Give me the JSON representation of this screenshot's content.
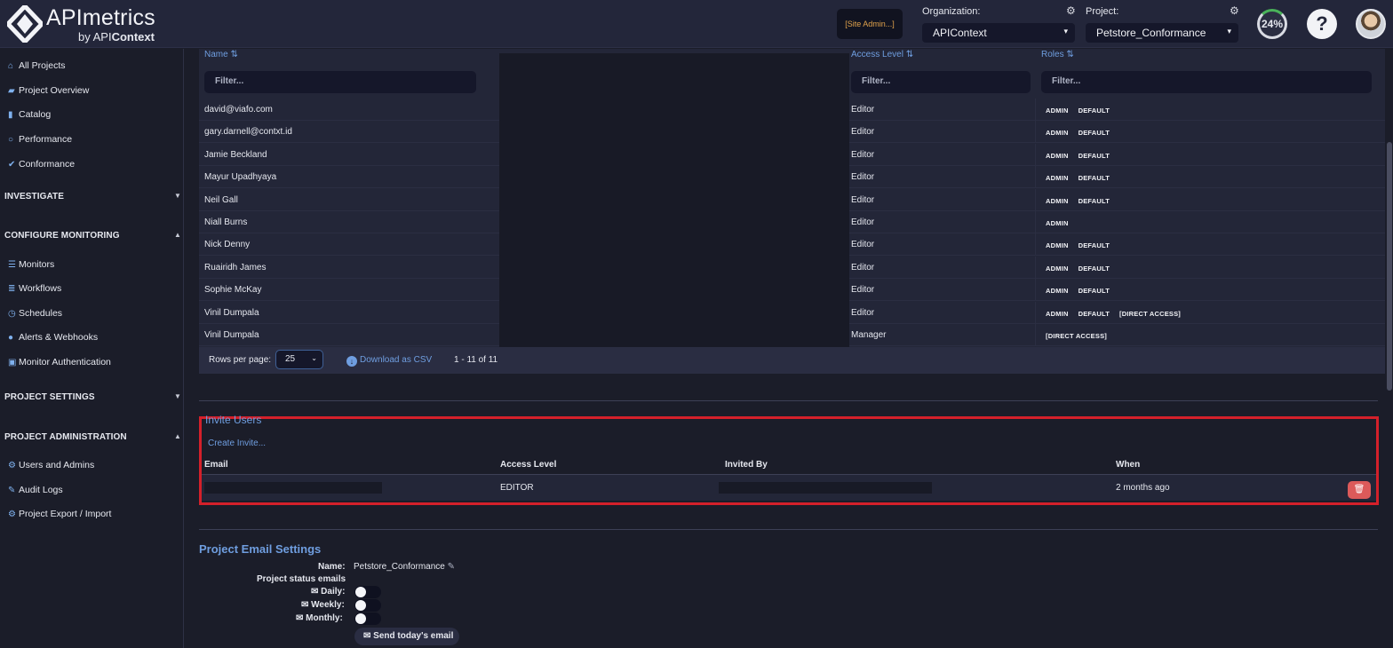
{
  "header": {
    "brand": "APImetrics",
    "brand_by": "by API",
    "brand_by_bold": "Context",
    "site_admin": "[Site Admin...]",
    "org_label": "Organization:",
    "org_value": "APIContext",
    "project_label": "Project:",
    "project_value": "Petstore_Conformance",
    "progress": "24%",
    "help": "?"
  },
  "sidebar": {
    "top_items": [
      {
        "label": "All Projects",
        "icon": "home-icon"
      },
      {
        "label": "Project Overview",
        "icon": "folder-icon"
      },
      {
        "label": "Catalog",
        "icon": "book-icon"
      },
      {
        "label": "Performance",
        "icon": "circle-icon"
      },
      {
        "label": "Conformance",
        "icon": "check-icon"
      }
    ],
    "investigate": "INVESTIGATE",
    "configure": "CONFIGURE MONITORING",
    "configure_items": [
      {
        "label": "Monitors",
        "icon": "list-icon"
      },
      {
        "label": "Workflows",
        "icon": "workflow-icon"
      },
      {
        "label": "Schedules",
        "icon": "clock-icon"
      },
      {
        "label": "Alerts & Webhooks",
        "icon": "globe-icon"
      },
      {
        "label": "Monitor Authentication",
        "icon": "lock-icon"
      }
    ],
    "project_settings": "PROJECT SETTINGS",
    "project_admin": "PROJECT ADMINISTRATION",
    "admin_items": [
      {
        "label": "Users and Admins",
        "icon": "gear-icon"
      },
      {
        "label": "Audit Logs",
        "icon": "edit-icon"
      },
      {
        "label": "Project Export / Import",
        "icon": "gear-icon"
      }
    ]
  },
  "users_table": {
    "headers": {
      "name": "Name",
      "access": "Access Level",
      "roles": "Roles"
    },
    "filter_placeholder": "Filter...",
    "rows": [
      {
        "name": "david@viafo.com",
        "access": "Editor",
        "roles": [
          "ADMIN",
          "DEFAULT"
        ]
      },
      {
        "name": "gary.darnell@contxt.id",
        "access": "Editor",
        "roles": [
          "ADMIN",
          "DEFAULT"
        ]
      },
      {
        "name": "Jamie Beckland",
        "access": "Editor",
        "roles": [
          "ADMIN",
          "DEFAULT"
        ]
      },
      {
        "name": "Mayur Upadhyaya",
        "access": "Editor",
        "roles": [
          "ADMIN",
          "DEFAULT"
        ]
      },
      {
        "name": "Neil Gall",
        "access": "Editor",
        "roles": [
          "ADMIN",
          "DEFAULT"
        ]
      },
      {
        "name": "Niall Burns",
        "access": "Editor",
        "roles": [
          "ADMIN"
        ]
      },
      {
        "name": "Nick Denny",
        "access": "Editor",
        "roles": [
          "ADMIN",
          "DEFAULT"
        ]
      },
      {
        "name": "Ruairidh James",
        "access": "Editor",
        "roles": [
          "ADMIN",
          "DEFAULT"
        ]
      },
      {
        "name": "Sophie McKay",
        "access": "Editor",
        "roles": [
          "ADMIN",
          "DEFAULT"
        ]
      },
      {
        "name": "Vinil Dumpala",
        "access": "Editor",
        "roles": [
          "ADMIN",
          "DEFAULT",
          "[DIRECT ACCESS]"
        ]
      },
      {
        "name": "Vinil Dumpala",
        "access": "Manager",
        "roles": [
          "[DIRECT ACCESS]"
        ]
      }
    ],
    "footer": {
      "rows_per_page_label": "Rows per page:",
      "rows_per_page": "25",
      "download": "Download as CSV",
      "range": "1 - 11 of 11"
    }
  },
  "invite": {
    "title": "Invite Users",
    "create": "Create Invite...",
    "headers": {
      "email": "Email",
      "access": "Access Level",
      "invited_by": "Invited By",
      "when": "When"
    },
    "row": {
      "access": "EDITOR",
      "when": "2 months ago"
    },
    "highlight_color": "#d4202a"
  },
  "email_settings": {
    "title": "Project Email Settings",
    "name_label": "Name:",
    "name_value": "Petstore_Conformance",
    "status_label": "Project status emails",
    "daily": "Daily:",
    "weekly": "Weekly:",
    "monthly": "Monthly:",
    "send": "Send today's email"
  },
  "colors": {
    "accent": "#6f9ee0",
    "bg": "#1b1d29",
    "danger": "#dc5a5a"
  }
}
